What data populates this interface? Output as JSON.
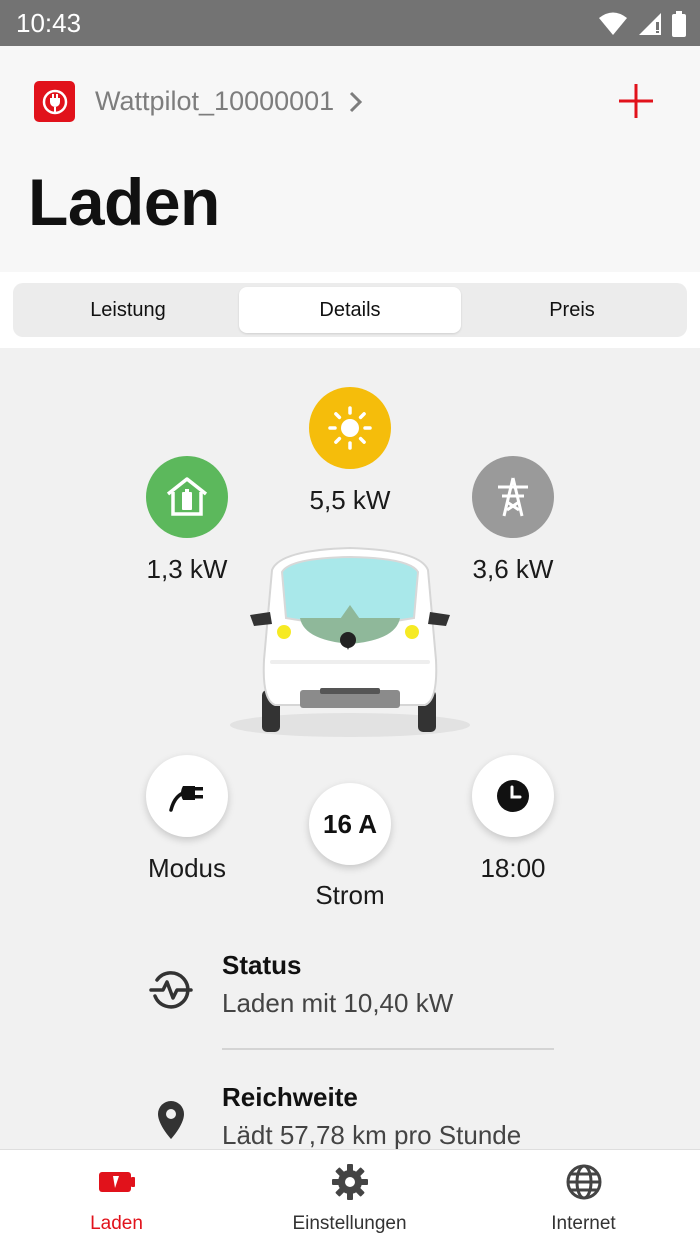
{
  "status_bar": {
    "time": "10:43"
  },
  "header": {
    "device_name": "Wattpilot_10000001",
    "title": "Laden"
  },
  "tabs": [
    {
      "label": "Leistung",
      "active": false
    },
    {
      "label": "Details",
      "active": true
    },
    {
      "label": "Preis",
      "active": false
    }
  ],
  "energy_flow": {
    "solar": {
      "value": "5,5 kW",
      "color": "#f5bd0b",
      "icon": "sun-icon"
    },
    "home_battery": {
      "value": "1,3 kW",
      "color": "#5cb85c",
      "icon": "home-battery-icon"
    },
    "grid": {
      "value": "3,6 kW",
      "color": "#9a9a9a",
      "icon": "power-pylon-icon"
    }
  },
  "controls": {
    "mode": {
      "label": "Modus",
      "icon": "plug-icon"
    },
    "current": {
      "value": "16 A",
      "label": "Strom"
    },
    "timer": {
      "label": "18:00",
      "icon": "clock-icon"
    }
  },
  "info": [
    {
      "title": "Status",
      "value": "Laden mit 10,40 kW",
      "icon": "pulse-icon"
    },
    {
      "title": "Reichweite",
      "value": "Lädt 57,78 km pro Stunde",
      "icon": "location-pin-icon"
    }
  ],
  "bottom_nav": [
    {
      "label": "Laden",
      "icon": "battery-charging-icon",
      "active": true
    },
    {
      "label": "Einstellungen",
      "icon": "gear-icon",
      "active": false
    },
    {
      "label": "Internet",
      "icon": "globe-icon",
      "active": false
    }
  ],
  "colors": {
    "accent": "#e1121b",
    "solar": "#f5bd0b",
    "battery": "#5cb85c",
    "grid": "#9a9a9a"
  }
}
